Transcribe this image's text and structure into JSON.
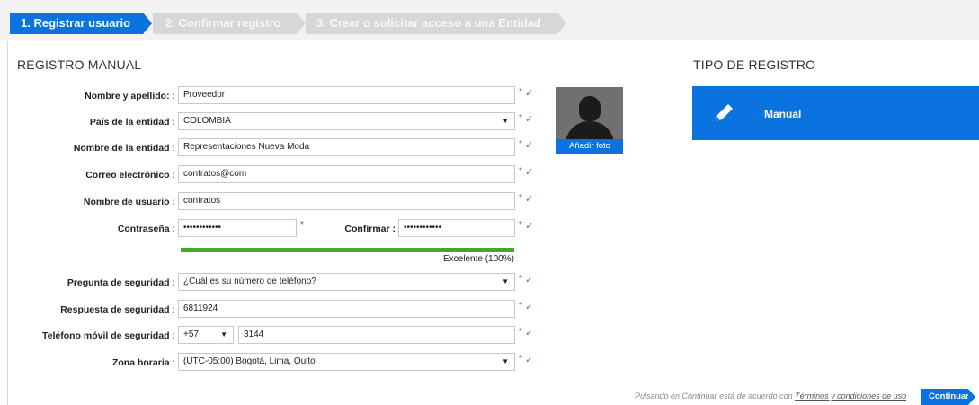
{
  "steps": [
    {
      "label": "1. Registrar usuario"
    },
    {
      "label": "2. Confirmar registro"
    },
    {
      "label": "3. Crear o solicitar acceso a una Entidad"
    }
  ],
  "registro_manual": {
    "title": "REGISTRO MANUAL",
    "fields": {
      "nombre": {
        "label": "Nombre y apellido: :",
        "value": "Proveedor"
      },
      "pais": {
        "label": "País de la entidad :",
        "value": "COLOMBIA"
      },
      "entidad": {
        "label": "Nombre de la entidad :",
        "value": "Representaciones Nueva Moda"
      },
      "correo": {
        "label": "Correo electrónico :",
        "value": "contratos@com"
      },
      "usuario": {
        "label": "Nombre de usuario :",
        "value": "contratos"
      },
      "contrasena": {
        "label": "Contraseña :",
        "value": "••••••••••••"
      },
      "confirmar": {
        "label": "Confirmar :",
        "value": "••••••••••••"
      },
      "pregunta": {
        "label": "Pregunta de seguridad :",
        "value": "¿Cuál es su número de teléfono?"
      },
      "respuesta": {
        "label": "Respuesta de seguridad :",
        "value": "6811924"
      },
      "telefono": {
        "label": "Teléfono móvil de seguridad :",
        "prefix": "+57",
        "value": "3144"
      },
      "zona": {
        "label": "Zona horaria :",
        "value": "(UTC-05:00) Bogotá, Lima, Quito"
      }
    },
    "strength_text": "Excelente  (100%)",
    "strength_fraction": 1.0,
    "required_mark": "*",
    "check_mark": "✓",
    "caret": "▼"
  },
  "photo": {
    "button_label": "Añadir foto"
  },
  "tipo_registro": {
    "title": "TIPO DE REGISTRO",
    "option_label": "Manual"
  },
  "footer": {
    "terms_prefix": "Pulsando en Continuar está de acuerdo con ",
    "terms_link": "Términos y condiciones de uso",
    "continue_label": "Continuar"
  },
  "colors": {
    "accent": "#0b73e0",
    "success": "#45a82c",
    "required": "#e0342c"
  }
}
